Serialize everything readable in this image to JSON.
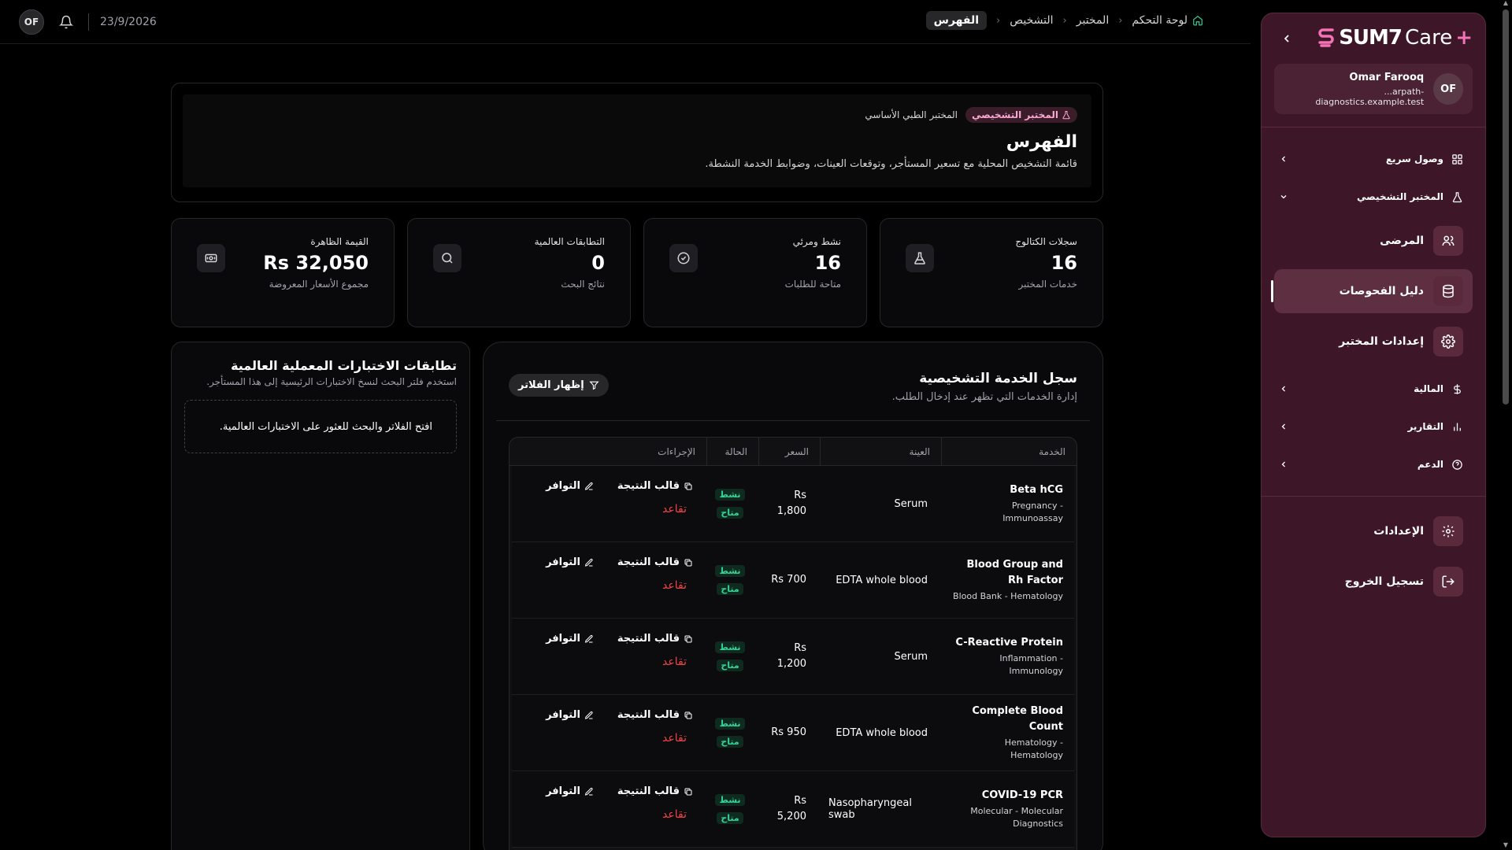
{
  "topbar": {
    "avatar_initials": "OF",
    "date": "23/9/2026",
    "breadcrumb": [
      "لوحة التحكم",
      "المختبر",
      "التشخيص",
      "الفهرس"
    ]
  },
  "hero": {
    "tag_primary": "المختبر التشخيصي",
    "tag_secondary": "المختبر الطبي الأساسي",
    "title": "الفهرس",
    "subtitle": "قائمة التشخيص المحلية مع تسعير المستأجر، وتوقعات العينات، وضوابط الخدمة النشطة."
  },
  "stats": [
    {
      "label": "سجلات الكتالوج",
      "value": "16",
      "sub": "خدمات المختبر",
      "icon": "flask-icon"
    },
    {
      "label": "نشط ومرئي",
      "value": "16",
      "sub": "متاحة للطلبات",
      "icon": "check-circle-icon"
    },
    {
      "label": "التطابقات العالمية",
      "value": "0",
      "sub": "نتائج البحث",
      "icon": "search-icon"
    },
    {
      "label": "القيمة الظاهرة",
      "value": "Rs 32,050",
      "sub": "مجموع الأسعار المعروضة",
      "icon": "banknote-icon"
    }
  ],
  "global_panel": {
    "title": "تطابقات الاختبارات المعملية العالمية",
    "subtitle": "استخدم فلتر البحث لنسخ الاختبارات الرئيسية إلى هذا المستأجر.",
    "empty": "افتح الفلاتر والبحث للعثور على الاختبارات العالمية."
  },
  "registry": {
    "title": "سجل الخدمة التشخيصية",
    "subtitle": "إدارة الخدمات التي تظهر عند إدخال الطلب.",
    "filter_button": "إظهار الفلاتر",
    "columns": [
      "الخدمة",
      "العينة",
      "السعر",
      "الحالة",
      "الإجراءات"
    ],
    "badge_active": "نشط",
    "badge_available": "متاح",
    "action_template": "قالب النتيجة",
    "action_availability": "التوافر",
    "action_retire": "تقاعد",
    "rows": [
      {
        "name": "Beta hCG",
        "category": "Pregnancy - Immunoassay",
        "sample": "Serum",
        "price_a": "Rs",
        "price_b": "1,800"
      },
      {
        "name": "Blood Group and Rh Factor",
        "category": "Blood Bank - Hematology",
        "sample": "EDTA whole blood",
        "price_a": "Rs 700",
        "price_b": ""
      },
      {
        "name": "C-Reactive Protein",
        "category": "Inflammation - Immunology",
        "sample": "Serum",
        "price_a": "Rs",
        "price_b": "1,200"
      },
      {
        "name": "Complete Blood Count",
        "category": "Hematology - Hematology",
        "sample": "EDTA whole blood",
        "price_a": "Rs 950",
        "price_b": ""
      },
      {
        "name": "COVID-19 PCR",
        "category": "Molecular - Molecular Diagnostics",
        "sample": "Nasopharyngeal swab",
        "price_a": "Rs",
        "price_b": "5,200"
      }
    ]
  },
  "sidebar": {
    "logo_text": "SUM7",
    "logo_care": "Care",
    "logo_plus": "+",
    "user_name": "Omar Farooq",
    "user_email": "...arpath-diagnostics.example.test",
    "user_initials": "OF",
    "quick_access": "وصول سريع",
    "lab_group": "المختبر التشخيصي",
    "patients": "المرضى",
    "test_directory": "دليل الفحوصات",
    "lab_settings": "إعدادات المختبر",
    "finance": "المالية",
    "reports": "التقارير",
    "support": "الدعم",
    "settings": "الإعدادات",
    "logout": "تسجيل الخروج"
  },
  "colors": {
    "sidebar_bg": "#3d1727",
    "accent_pink": "#f472b6",
    "status_green": "#34d399",
    "danger_red": "#ef4444"
  }
}
